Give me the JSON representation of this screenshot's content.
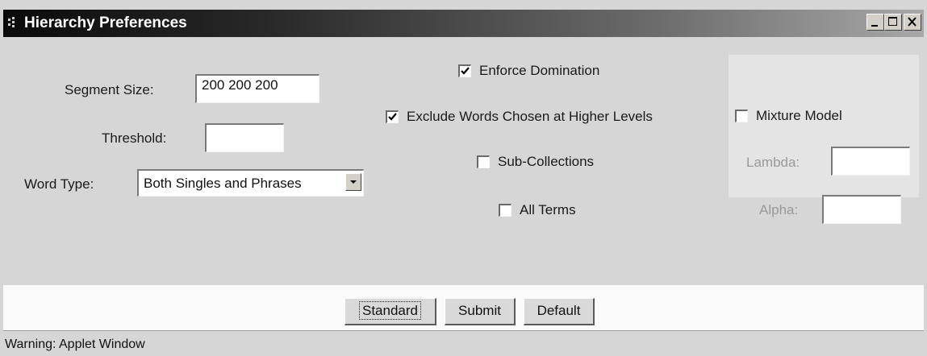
{
  "window": {
    "title": "Hierarchy Preferences",
    "icon": "app-icon",
    "controls": [
      "minimize-icon",
      "maximize-icon",
      "close-icon"
    ]
  },
  "form": {
    "segment_size_label": "Segment Size:",
    "segment_size_value": "200 200 200",
    "threshold_label": "Threshold:",
    "threshold_value": "",
    "word_type_label": "Word Type:",
    "word_type_value": "Both Singles and Phrases"
  },
  "options": {
    "enforce_domination": {
      "label": "Enforce Domination",
      "checked": true
    },
    "exclude_words": {
      "label": "Exclude Words Chosen at Higher Levels",
      "checked": true
    },
    "sub_collections": {
      "label": "Sub-Collections",
      "checked": false
    },
    "all_terms": {
      "label": "All Terms",
      "checked": false
    }
  },
  "mixture": {
    "label": "Mixture Model",
    "checked": false,
    "lambda_label": "Lambda:",
    "lambda_value": "",
    "alpha_label": "Alpha:",
    "alpha_value": ""
  },
  "buttons": {
    "standard": "Standard",
    "submit": "Submit",
    "default": "Default"
  },
  "status": {
    "text": "Warning: Applet Window"
  },
  "colors": {
    "titlebar_start": "#0b0b0b",
    "titlebar_end": "#a8a8a8",
    "panel": "#d6d6d6"
  }
}
